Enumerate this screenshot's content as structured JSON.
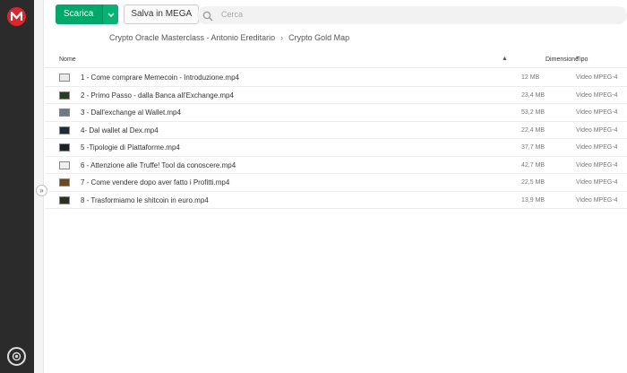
{
  "toolbar": {
    "download_label": "Scarica",
    "save_label": "Salva in MEGA"
  },
  "search": {
    "placeholder": "Cerca"
  },
  "breadcrumb": [
    "Crypto Oracle Masterclass - Antonio Ereditario",
    "Crypto Gold Map"
  ],
  "columns": {
    "name": "Nome",
    "size": "Dimensione",
    "type": "Tipo"
  },
  "files": [
    {
      "name": "1 - Come comprare Memecoin - Introduzione.mp4",
      "size": "12 MB",
      "type": "Video MPEG-4",
      "thumb": "#e9e9e9"
    },
    {
      "name": "2 - Primo Passo - dalla Banca all'Exchange.mp4",
      "size": "23,4 MB",
      "type": "Video MPEG-4",
      "thumb": "#2b3a22"
    },
    {
      "name": "3 - Dall'exchange al Wallet.mp4",
      "size": "53,2 MB",
      "type": "Video MPEG-4",
      "thumb": "#6d7a8c"
    },
    {
      "name": "4- Dal wallet al Dex.mp4",
      "size": "22,4 MB",
      "type": "Video MPEG-4",
      "thumb": "#1f2a33"
    },
    {
      "name": "5 -Tipologie di Piattaforme.mp4",
      "size": "37,7 MB",
      "type": "Video MPEG-4",
      "thumb": "#1c232b"
    },
    {
      "name": "6 - Attenzione alle Truffe! Tool da conoscere.mp4",
      "size": "42,7 MB",
      "type": "Video MPEG-4",
      "thumb": "#f0f0f0"
    },
    {
      "name": "7 - Come vendere dopo aver fatto i Profitti.mp4",
      "size": "22,5 MB",
      "type": "Video MPEG-4",
      "thumb": "#6b4a1f"
    },
    {
      "name": "8 - Trasformiamo le shitcoin in euro.mp4",
      "size": "13,9 MB",
      "type": "Video MPEG-4",
      "thumb": "#2a3322"
    }
  ]
}
